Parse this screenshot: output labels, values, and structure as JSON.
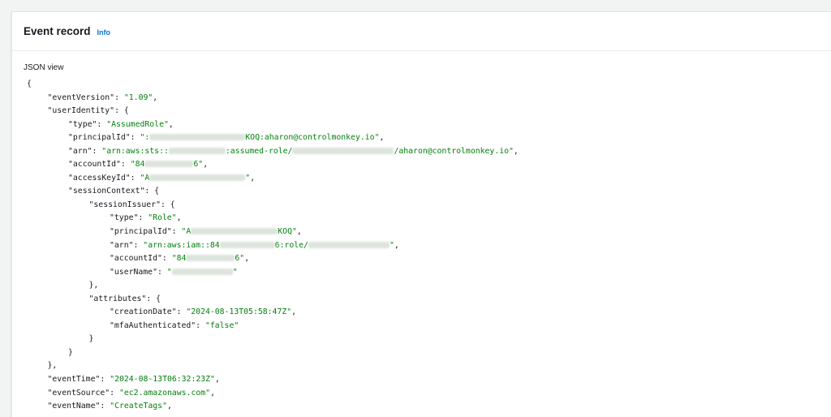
{
  "header": {
    "title": "Event record",
    "info_label": "Info"
  },
  "view_label": "JSON view",
  "json_lines": [
    {
      "indent": 0,
      "parts": [
        {
          "t": "p",
          "v": "{"
        }
      ]
    },
    {
      "indent": 1,
      "parts": [
        {
          "t": "k",
          "v": "\"eventVersion\": "
        },
        {
          "t": "s",
          "v": "\"1.09\""
        },
        {
          "t": "p",
          "v": ","
        }
      ]
    },
    {
      "indent": 1,
      "parts": [
        {
          "t": "k",
          "v": "\"userIdentity\": {"
        }
      ]
    },
    {
      "indent": 2,
      "parts": [
        {
          "t": "k",
          "v": "\"type\": "
        },
        {
          "t": "s",
          "v": "\"AssumedRole\""
        },
        {
          "t": "p",
          "v": ","
        }
      ]
    },
    {
      "indent": 2,
      "parts": [
        {
          "t": "k",
          "v": "\"principalId\": "
        },
        {
          "t": "s",
          "v": "\":"
        },
        {
          "t": "r",
          "w": 118
        },
        {
          "t": "s",
          "v": "KOQ:aharon@controlmonkey.io\""
        },
        {
          "t": "p",
          "v": ","
        }
      ]
    },
    {
      "indent": 2,
      "parts": [
        {
          "t": "k",
          "v": "\"arn\": "
        },
        {
          "t": "s",
          "v": "\"arn:aws:sts::"
        },
        {
          "t": "r",
          "w": 70
        },
        {
          "t": "s",
          "v": ":assumed-role/"
        },
        {
          "t": "r",
          "w": 125
        },
        {
          "t": "s",
          "v": "/aharon@controlmonkey.io\""
        },
        {
          "t": "p",
          "v": ","
        }
      ]
    },
    {
      "indent": 2,
      "parts": [
        {
          "t": "k",
          "v": "\"accountId\": "
        },
        {
          "t": "s",
          "v": "\"84"
        },
        {
          "t": "r",
          "w": 60
        },
        {
          "t": "s",
          "v": "6\""
        },
        {
          "t": "p",
          "v": ","
        }
      ]
    },
    {
      "indent": 2,
      "parts": [
        {
          "t": "k",
          "v": "\"accessKeyId\": "
        },
        {
          "t": "s",
          "v": "\"A"
        },
        {
          "t": "r",
          "w": 118
        },
        {
          "t": "s",
          "v": "\""
        },
        {
          "t": "p",
          "v": ","
        }
      ]
    },
    {
      "indent": 2,
      "parts": [
        {
          "t": "k",
          "v": "\"sessionContext\": {"
        }
      ]
    },
    {
      "indent": 3,
      "parts": [
        {
          "t": "k",
          "v": "\"sessionIssuer\": {"
        }
      ]
    },
    {
      "indent": 4,
      "parts": [
        {
          "t": "k",
          "v": "\"type\": "
        },
        {
          "t": "s",
          "v": "\"Role\""
        },
        {
          "t": "p",
          "v": ","
        }
      ]
    },
    {
      "indent": 4,
      "parts": [
        {
          "t": "k",
          "v": "\"principalId\": "
        },
        {
          "t": "s",
          "v": "\"A"
        },
        {
          "t": "r",
          "w": 107
        },
        {
          "t": "s",
          "v": "KOQ\""
        },
        {
          "t": "p",
          "v": ","
        }
      ]
    },
    {
      "indent": 4,
      "parts": [
        {
          "t": "k",
          "v": "\"arn\": "
        },
        {
          "t": "s",
          "v": "\"arn:aws:iam::84"
        },
        {
          "t": "r",
          "w": 68
        },
        {
          "t": "s",
          "v": "6:role/"
        },
        {
          "t": "r",
          "w": 100
        },
        {
          "t": "s",
          "v": "\""
        },
        {
          "t": "p",
          "v": ","
        }
      ]
    },
    {
      "indent": 4,
      "parts": [
        {
          "t": "k",
          "v": "\"accountId\": "
        },
        {
          "t": "s",
          "v": "\"84"
        },
        {
          "t": "r",
          "w": 60
        },
        {
          "t": "s",
          "v": "6\""
        },
        {
          "t": "p",
          "v": ","
        }
      ]
    },
    {
      "indent": 4,
      "parts": [
        {
          "t": "k",
          "v": "\"userName\": "
        },
        {
          "t": "s",
          "v": "\""
        },
        {
          "t": "r",
          "w": 75
        },
        {
          "t": "s",
          "v": "\""
        }
      ]
    },
    {
      "indent": 3,
      "parts": [
        {
          "t": "p",
          "v": "},"
        }
      ]
    },
    {
      "indent": 3,
      "parts": [
        {
          "t": "k",
          "v": "\"attributes\": {"
        }
      ]
    },
    {
      "indent": 4,
      "parts": [
        {
          "t": "k",
          "v": "\"creationDate\": "
        },
        {
          "t": "s",
          "v": "\"2024-08-13T05:58:47Z\""
        },
        {
          "t": "p",
          "v": ","
        }
      ]
    },
    {
      "indent": 4,
      "parts": [
        {
          "t": "k",
          "v": "\"mfaAuthenticated\": "
        },
        {
          "t": "s",
          "v": "\"false\""
        }
      ]
    },
    {
      "indent": 3,
      "parts": [
        {
          "t": "p",
          "v": "}"
        }
      ]
    },
    {
      "indent": 2,
      "parts": [
        {
          "t": "p",
          "v": "}"
        }
      ]
    },
    {
      "indent": 1,
      "parts": [
        {
          "t": "p",
          "v": "},"
        }
      ]
    },
    {
      "indent": 1,
      "parts": [
        {
          "t": "k",
          "v": "\"eventTime\": "
        },
        {
          "t": "s",
          "v": "\"2024-08-13T06:32:23Z\""
        },
        {
          "t": "p",
          "v": ","
        }
      ]
    },
    {
      "indent": 1,
      "parts": [
        {
          "t": "k",
          "v": "\"eventSource\": "
        },
        {
          "t": "s",
          "v": "\"ec2.amazonaws.com\""
        },
        {
          "t": "p",
          "v": ","
        }
      ]
    },
    {
      "indent": 1,
      "parts": [
        {
          "t": "k",
          "v": "\"eventName\": "
        },
        {
          "t": "s",
          "v": "\"CreateTags\""
        },
        {
          "t": "p",
          "v": ","
        }
      ]
    }
  ]
}
